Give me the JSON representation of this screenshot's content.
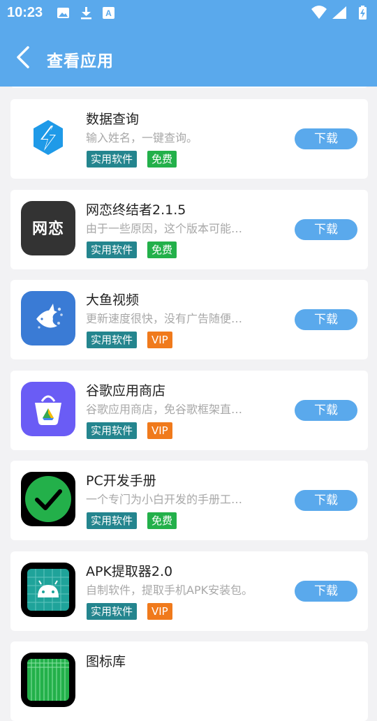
{
  "status_bar": {
    "time": "10:23",
    "icons_left": [
      "image-icon",
      "download-icon",
      "a-badge-icon"
    ],
    "icons_right": [
      "wifi-icon",
      "signal-icon",
      "battery-icon"
    ]
  },
  "header": {
    "title": "查看应用",
    "background": "#5aa9ec"
  },
  "common": {
    "download_label": "下载",
    "category_label": "实用软件",
    "free_label": "免费",
    "vip_label": "VIP"
  },
  "apps": [
    {
      "name": "数据查询",
      "desc": "输入姓名，一键查询。",
      "badge": "免费",
      "icon": "lightning-hexagon-icon"
    },
    {
      "name": "网恋终结者2.1.5",
      "desc": "由于一些原因，这个版本可能…",
      "badge": "免费",
      "icon": "wanglian-logo-icon",
      "icon_text": "网恋"
    },
    {
      "name": "大鱼视频",
      "desc": "更新速度很快，没有广告随便…",
      "badge": "VIP",
      "icon": "fish-icon"
    },
    {
      "name": "谷歌应用商店",
      "desc": "谷歌应用商店，免谷歌框架直…",
      "badge": "VIP",
      "icon": "play-store-bag-icon"
    },
    {
      "name": "PC开发手册",
      "desc": "一个专门为小白开发的手册工…",
      "badge": "免费",
      "icon": "checkmark-circle-icon"
    },
    {
      "name": "APK提取器2.0",
      "desc": "自制软件，提取手机APK安装包。",
      "badge": "VIP",
      "icon": "android-robot-icon"
    },
    {
      "name": "图标库",
      "desc": "",
      "badge": "",
      "icon": "grid-icon"
    }
  ],
  "colors": {
    "accent": "#5aa9ec",
    "category_tag": "#24858e",
    "free_tag": "#23b04a",
    "vip_tag": "#f07a1c"
  }
}
